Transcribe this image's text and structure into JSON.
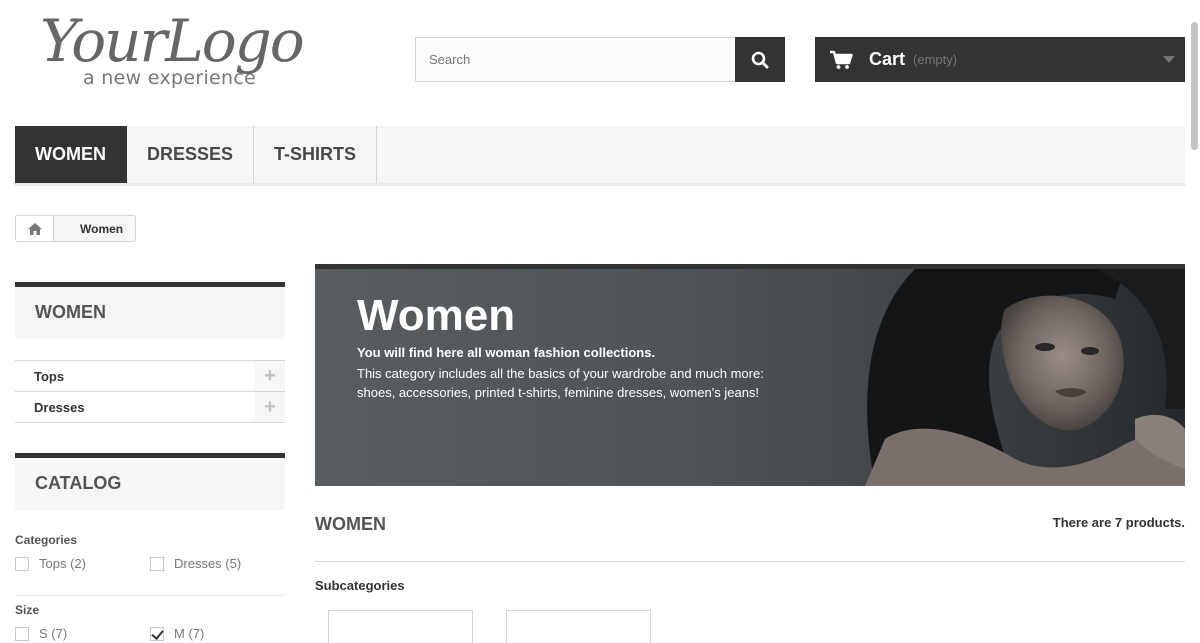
{
  "logo": {
    "text": "YourLogo",
    "tagline": "a new experience"
  },
  "search": {
    "placeholder": "Search",
    "button_icon": "search-icon"
  },
  "cart": {
    "label": "Cart",
    "status": "(empty)",
    "icon": "cart-icon"
  },
  "menu": {
    "items": [
      {
        "label": "WOMEN",
        "active": true
      },
      {
        "label": "DRESSES",
        "active": false
      },
      {
        "label": "T-SHIRTS",
        "active": false
      }
    ]
  },
  "breadcrumb": {
    "home_icon": "home-icon",
    "current": "Women"
  },
  "sidebar": {
    "category_title": "WOMEN",
    "categories": [
      {
        "label": "Tops"
      },
      {
        "label": "Dresses"
      }
    ],
    "catalog_title": "CATALOG",
    "filters": {
      "categories_heading": "Categories",
      "categories": [
        {
          "label": "Tops (2)",
          "checked": false
        },
        {
          "label": "Dresses (5)",
          "checked": false
        }
      ],
      "size_heading": "Size",
      "sizes": [
        {
          "label": "S (7)",
          "checked": false
        },
        {
          "label": "M (7)",
          "checked": true
        }
      ]
    }
  },
  "banner": {
    "title": "Women",
    "intro": "You will find here all woman fashion collections.",
    "text": "This category includes all the basics of your wardrobe and much more: shoes, accessories, printed t-shirts, feminine dresses, women's jeans!"
  },
  "main": {
    "heading": "WOMEN",
    "product_count": "There are 7 products.",
    "subcategories_heading": "Subcategories"
  },
  "colors": {
    "dark": "#333333",
    "light_bg": "#f6f6f6",
    "border": "#d6d4d4"
  }
}
